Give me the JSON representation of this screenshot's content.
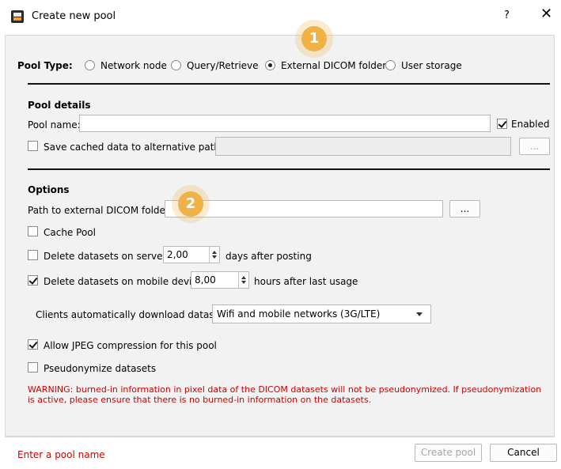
{
  "window": {
    "title": "Create new pool",
    "help": "?",
    "close": "✕"
  },
  "pool_type": {
    "label": "Pool Type:",
    "options": [
      "Network node",
      "Query/Retrieve",
      "External DICOM folder",
      "User storage"
    ],
    "selected": "External DICOM folder"
  },
  "pool_details": {
    "heading": "Pool details",
    "name_label": "Pool name:",
    "name_value": "",
    "enabled_label": "Enabled",
    "enabled_checked": true,
    "alt_path_label": "Save cached data to alternative path:",
    "alt_path_checked": false,
    "alt_path_value": "",
    "browse": "..."
  },
  "options": {
    "heading": "Options",
    "path_label": "Path to external DICOM folder:",
    "path_value": "",
    "browse": "...",
    "cache_pool_label": "Cache Pool",
    "cache_pool_checked": false,
    "delete_server_label": "Delete datasets on server",
    "delete_server_checked": false,
    "delete_server_value": "2,00",
    "delete_server_suffix": "days after posting",
    "delete_mobile_label": "Delete datasets on mobile device",
    "delete_mobile_checked": true,
    "delete_mobile_value": "8,00",
    "delete_mobile_suffix": "hours after last usage",
    "download_label": "Clients automatically download datasets:",
    "download_value": "Wifi and mobile networks (3G/LTE)",
    "jpeg_label": "Allow JPEG compression for this pool",
    "jpeg_checked": true,
    "pseudo_label": "Pseudonymize datasets",
    "pseudo_checked": false,
    "warning": "WARNING: burned-in information in pixel data of the DICOM datasets will not be pseudonymized. If pseudonymization is active, please ensure that there is no burned-in information on the datasets."
  },
  "markers": [
    "1",
    "2"
  ],
  "footer": {
    "error": "Enter a pool name",
    "create": "Create pool",
    "cancel": "Cancel"
  },
  "colors": {
    "error": "#d10000",
    "marker": "#f0b247"
  }
}
